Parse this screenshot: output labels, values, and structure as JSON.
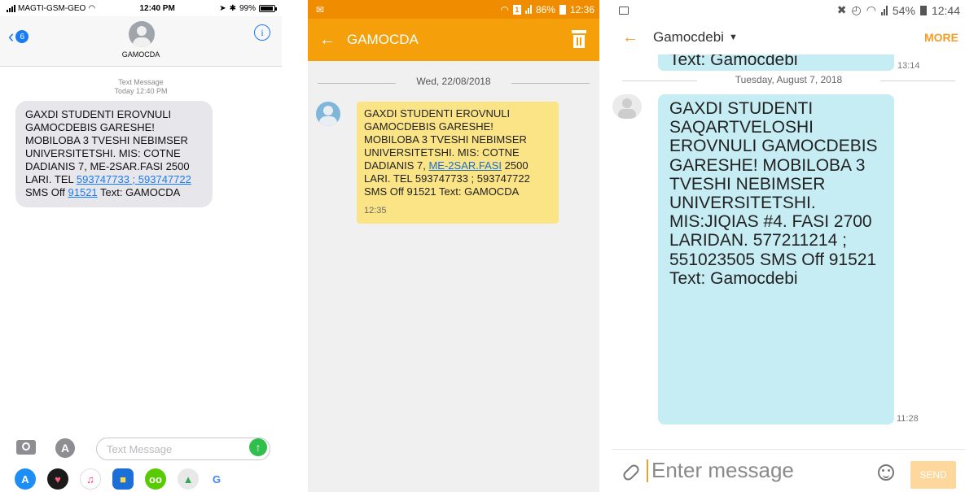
{
  "ios": {
    "status": {
      "carrier": "MAGTI-GSM-GEO",
      "time": "12:40 PM",
      "battery": "99%"
    },
    "nav": {
      "back_count": "6",
      "contact": "GAMOCDA",
      "info_glyph": "i"
    },
    "thread": {
      "label": "Text Message",
      "time": "Today 12:40 PM"
    },
    "message": {
      "text_before": "GAXDI STUDENTI EROVNULI GAMOCDEBIS GARESHE! MOBILOBA 3 TVESHI NEBIMSER UNIVERSITETSHI. MIS: COTNE DADIANIS 7, ME-2SAR.FASI 2500 LARI. TEL ",
      "link_phones": "593747733 ; 593747722",
      "text_mid": " SMS Off ",
      "link_code": "91521",
      "text_after": " Text: GAMOCDA"
    },
    "input_placeholder": "Text Message",
    "dock_apps": [
      "app-store",
      "heart-app",
      "music",
      "messages-app",
      "duolingo",
      "maps",
      "chrome"
    ]
  },
  "samsung_orange": {
    "status": {
      "signal": "86%",
      "time": "12:36"
    },
    "appbar": {
      "title": "GAMOCDA"
    },
    "date": "Wed, 22/08/2018",
    "message": {
      "text_before": "GAXDI STUDENTI EROVNULI GAMOCDEBIS GARESHE! MOBILOBA 3 TVESHI NEBIMSER UNIVERSITETSHI. MIS: COTNE DADIANIS 7, ",
      "link": "ME-2SAR.FASI",
      "text_after": " 2500 LARI. TEL 593747733 ; 593747722 SMS Off 91521 Text: GAMOCDA",
      "time": "12:35"
    }
  },
  "samsung_blue": {
    "status": {
      "battery": "54%",
      "time": "12:44"
    },
    "appbar": {
      "title": "Gamocdebi",
      "more": "MORE"
    },
    "prev_message": {
      "text": "Text: Gamocdebi",
      "time": "13:14"
    },
    "date": "Tuesday, August 7, 2018",
    "message": {
      "text": "GAXDI STUDENTI SAQARTVELOSHI EROVNULI GAMOCDEBIS GARESHE! MOBILOBA 3 TVESHI NEBIMSER UNIVERSITETSHI. MIS:JIQIAS #4. FASI 2700 LARIDAN. 577211214 ; 551023505 SMS Off 91521 Text: Gamocdebi",
      "time": "11:28"
    },
    "input_placeholder": "Enter message",
    "send_label": "SEND"
  },
  "colors": {
    "ios_blue": "#1a7cf5",
    "ios_bubble": "#e6e6eb",
    "samsung_orange": "#f5a00b",
    "samsung_yellow_bubble": "#fbe485",
    "samsung_blue_bubble": "#c6ecf4"
  }
}
